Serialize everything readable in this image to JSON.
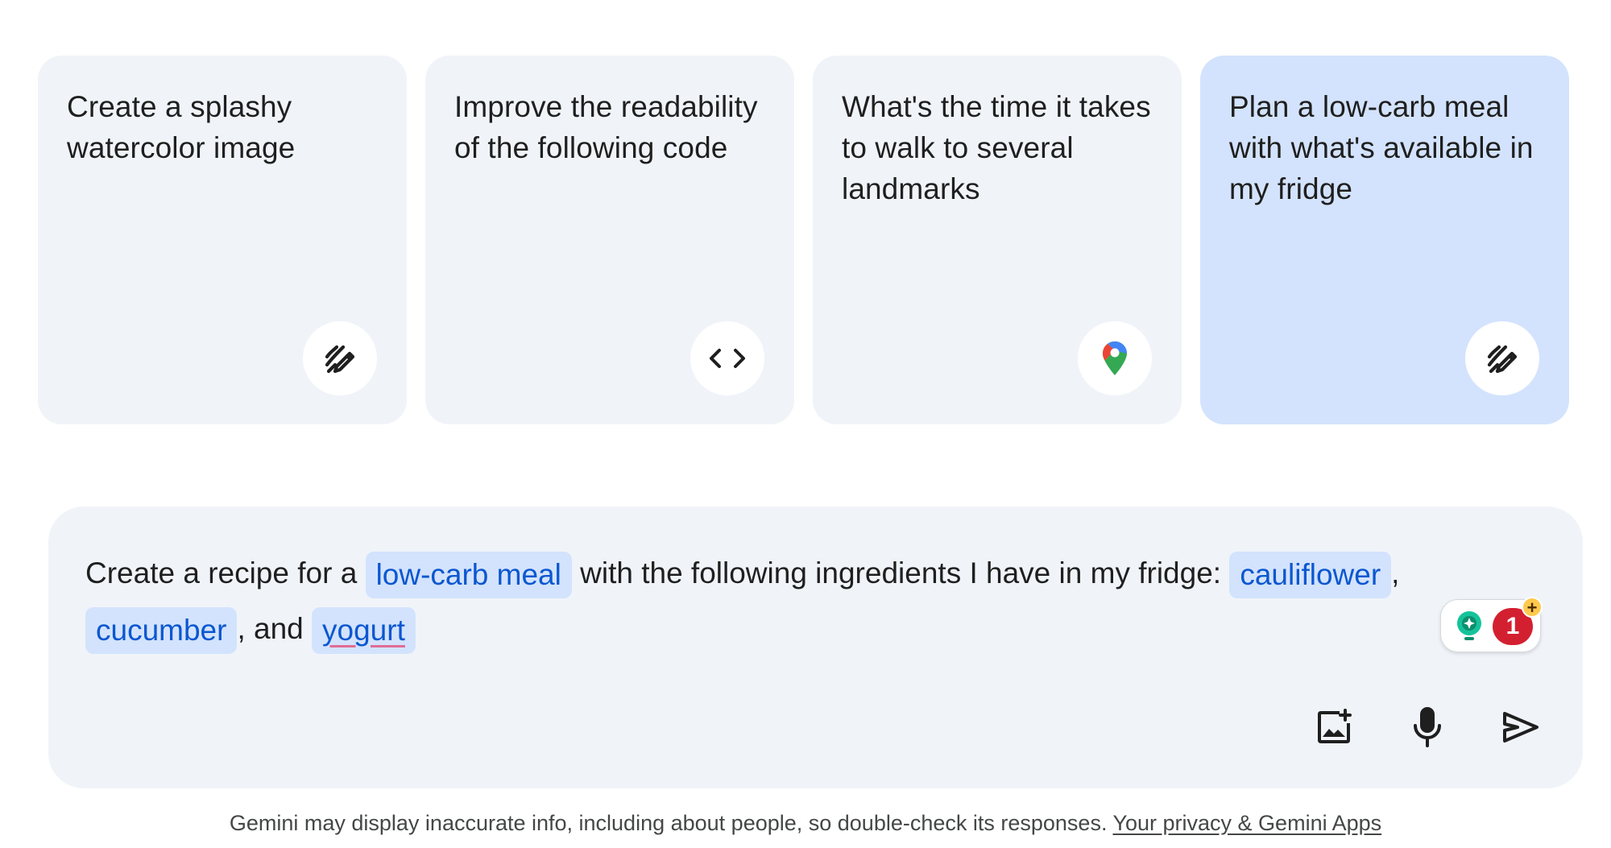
{
  "suggestions": [
    {
      "text": "Create a splashy watercolor image",
      "icon": "edit-sparkle-icon",
      "active": false
    },
    {
      "text": "Improve the readability of the following code",
      "icon": "code-icon",
      "active": false
    },
    {
      "text": "What's the time it takes to walk to several landmarks",
      "icon": "google-maps-pin-icon",
      "active": false
    },
    {
      "text": "Plan a low-carb meal with what's available in my fridge",
      "icon": "edit-sparkle-icon",
      "active": true
    }
  ],
  "prompt": {
    "part1": "Create a recipe for a ",
    "chip1": "low-carb meal",
    "part2": " with the following ingredients I have in my fridge: ",
    "chip2": "cauliflower",
    "part3": ",",
    "chip3": "cucumber",
    "part4": ", and ",
    "chip4": "yogurt"
  },
  "grammar_widget": {
    "count": "1",
    "plus": "+"
  },
  "actions": {
    "upload_image_icon": "add-image-icon",
    "mic_icon": "microphone-icon",
    "send_icon": "send-icon"
  },
  "footer": {
    "disclaimer": "Gemini may display inaccurate info, including about people, so double-check its responses. ",
    "link": "Your privacy & Gemini Apps"
  },
  "colors": {
    "card_bg": "#f0f4f9",
    "card_active_bg": "#d3e3fd",
    "chip_text": "#0b57d0",
    "badge_red": "#d32030"
  }
}
